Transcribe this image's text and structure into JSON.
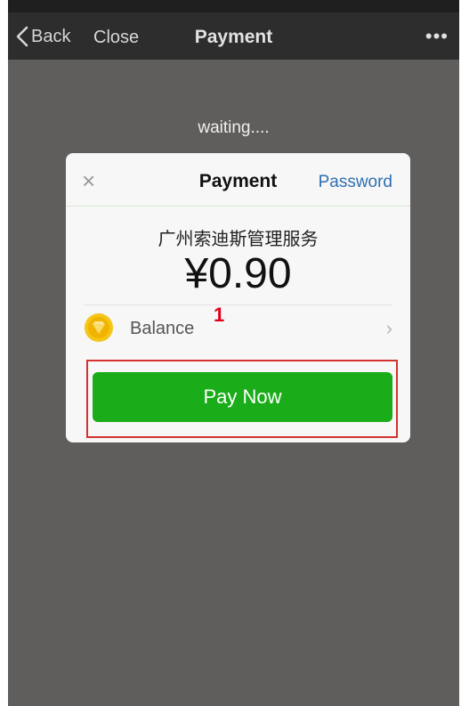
{
  "nav": {
    "back_label": "Back",
    "close_label": "Close",
    "title": "Payment",
    "more_label": "•••"
  },
  "status": {
    "waiting_text": "waiting...."
  },
  "dialog": {
    "close_glyph": "×",
    "title": "Payment",
    "password_label": "Password",
    "merchant": "广州索迪斯管理服务",
    "amount": "¥0.90",
    "payment_method": {
      "icon": "balance-coin-icon",
      "label": "Balance",
      "chevron": "›"
    },
    "pay_button_label": "Pay Now"
  },
  "annotation": {
    "step_number": "1",
    "color": "#e0001b",
    "box_color": "#d3322f"
  },
  "colors": {
    "pay_button": "#1aac19",
    "link": "#2f6fb0",
    "coin": "#f5c518"
  }
}
